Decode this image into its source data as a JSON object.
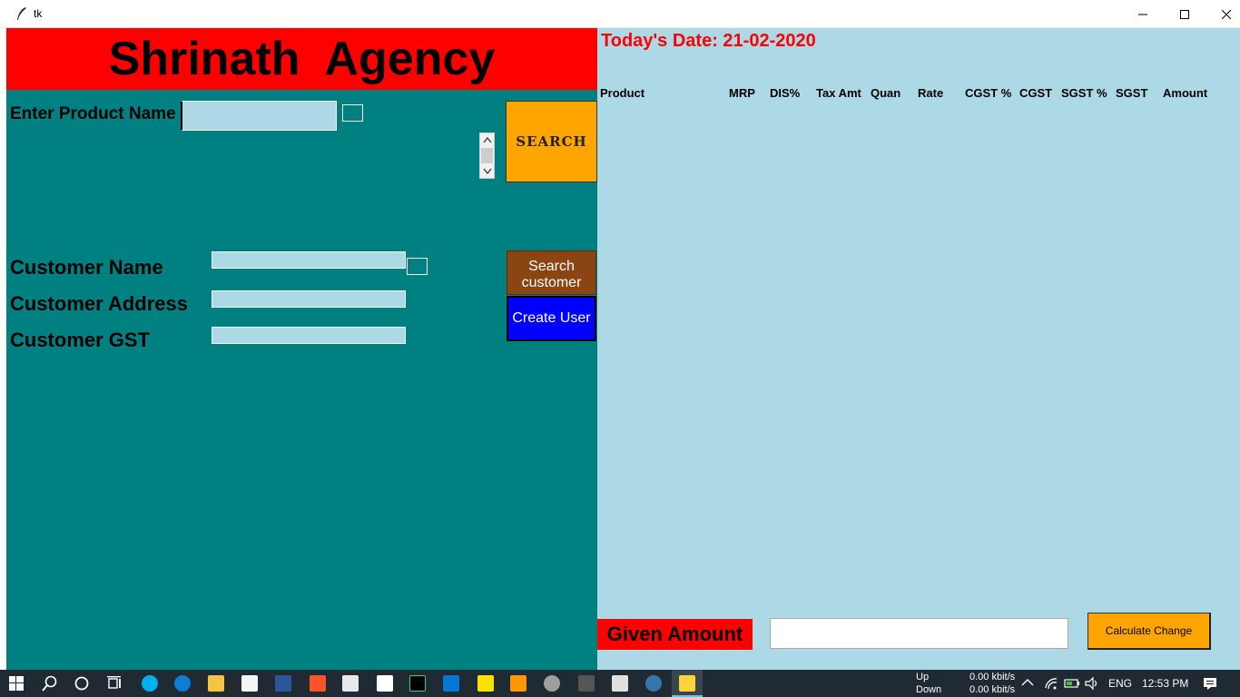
{
  "window": {
    "title": "tk"
  },
  "header": {
    "title": "Shrinath  Agency"
  },
  "product_search": {
    "label": "Enter Product Name",
    "value": "",
    "search_button": "SEARCH"
  },
  "customer": {
    "name_label": "Customer Name",
    "address_label": "Customer Address",
    "gst_label": "Customer GST",
    "name_value": "",
    "address_value": "",
    "gst_value": "",
    "search_button": "Search customer",
    "create_button": "Create User"
  },
  "bill": {
    "date_text": "Today's Date: 21-02-2020",
    "columns": [
      "Product",
      "MRP",
      "DIS%",
      "Tax Amt",
      "Quan",
      "Rate",
      "CGST %",
      "CGST",
      "SGST %",
      "SGST",
      "Amount"
    ],
    "rows": []
  },
  "payment": {
    "given_label": "Given Amount",
    "given_value": "",
    "calculate_button": "Calculate Change"
  },
  "taskbar": {
    "net_up_label": "Up",
    "net_down_label": "Down",
    "net_up_value": "0.00 kbit/s",
    "net_down_value": "0.00 kbit/s",
    "language": "ENG",
    "clock": "12:53 PM",
    "icons": [
      "windows-start-icon",
      "search-icon",
      "cortana-icon",
      "task-view-icon",
      "skype-icon",
      "edge-icon",
      "file-explorer-icon",
      "store-icon",
      "word-icon",
      "brave-icon",
      "mail-icon",
      "file-icon",
      "pycharm-icon",
      "vscode-icon",
      "sticky-notes-icon",
      "sublime-icon",
      "database-icon",
      "calculator-icon",
      "camera-icon",
      "python-icon",
      "python-tk-icon"
    ]
  },
  "colors": {
    "left_bg": "#008080",
    "right_bg": "#add8e6",
    "header_bg": "#ff0000",
    "search_bg": "#ffa500",
    "search_customer_bg": "#8b4513",
    "create_user_bg": "#0000ff"
  }
}
